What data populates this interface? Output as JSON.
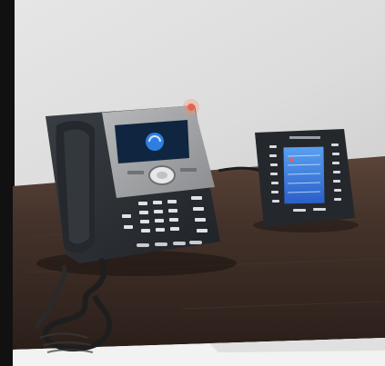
{
  "photo": {
    "subject": "desk-ip-phone-with-expansion-module",
    "colors": {
      "wall": "#dedede",
      "desk": "#3a2b24",
      "phone_body": "#2a2e33",
      "phone_panel": "#9a9c9e",
      "phone_screen": "#0f2540",
      "screen_blue": "#2e7fe0",
      "indicator_led": "#e0553a"
    },
    "icons": [
      "handset-icon",
      "nav-ring-icon",
      "keypad-icon",
      "expansion-screen-icon",
      "coiled-cord-icon"
    ]
  }
}
